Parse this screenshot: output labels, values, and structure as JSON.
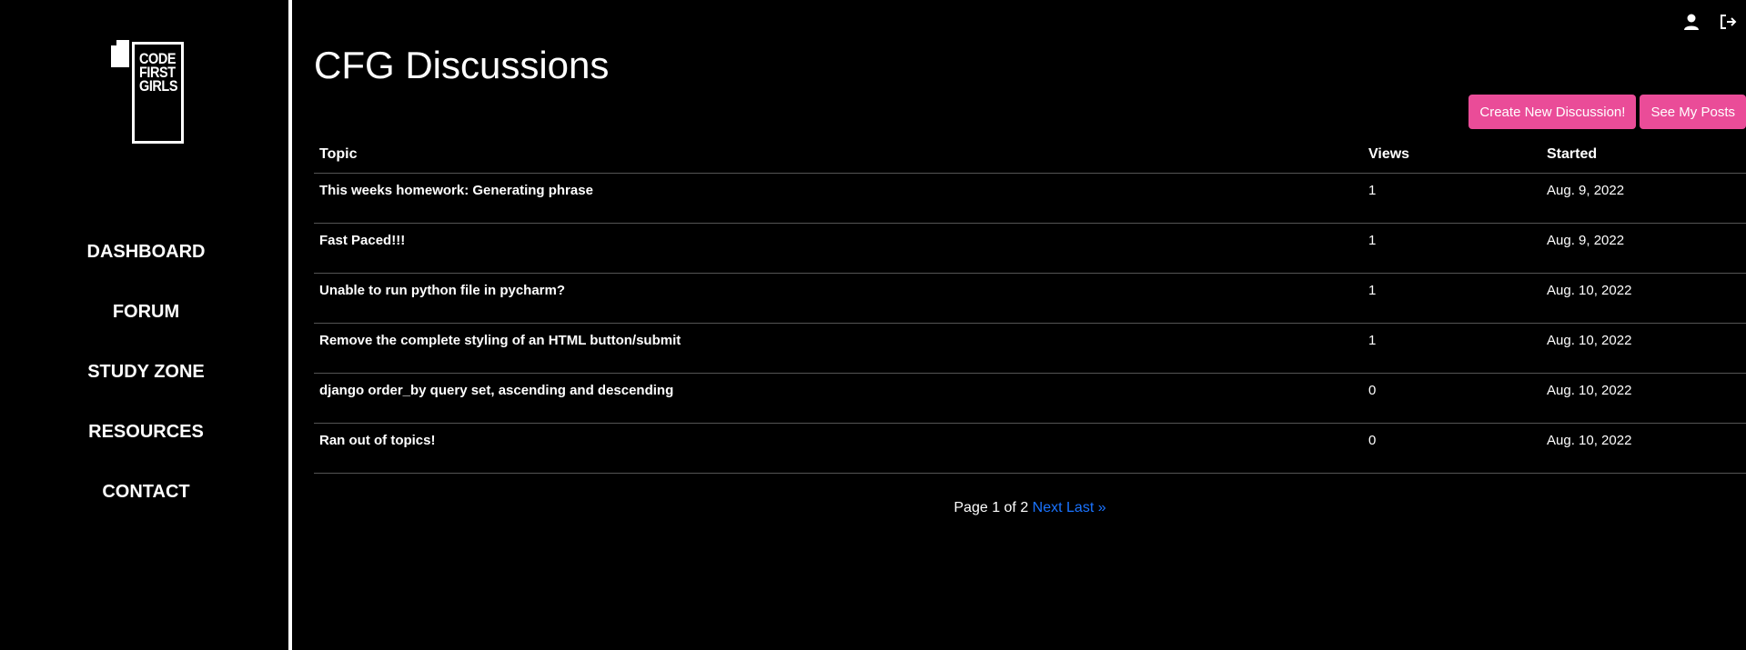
{
  "brand": {
    "logo_lines": [
      "CODE",
      "FIRST",
      "GIRLS"
    ]
  },
  "sidebar": {
    "items": [
      {
        "label": "DASHBOARD"
      },
      {
        "label": "FORUM"
      },
      {
        "label": "STUDY ZONE"
      },
      {
        "label": "RESOURCES"
      },
      {
        "label": "CONTACT"
      }
    ]
  },
  "header": {
    "icons": [
      "user-icon",
      "logout-icon"
    ]
  },
  "main": {
    "title": "CFG Discussions",
    "actions": {
      "create_label": "Create New Discussion!",
      "my_posts_label": "See My Posts"
    },
    "table": {
      "columns": [
        "Topic",
        "Views",
        "Started"
      ],
      "rows": [
        {
          "topic": "This weeks homework: Generating phrase",
          "views": "1",
          "started": "Aug. 9, 2022"
        },
        {
          "topic": "Fast Paced!!!",
          "views": "1",
          "started": "Aug. 9, 2022"
        },
        {
          "topic": "Unable to run python file in pycharm?",
          "views": "1",
          "started": "Aug. 10, 2022"
        },
        {
          "topic": "Remove the complete styling of an HTML button/submit",
          "views": "1",
          "started": "Aug. 10, 2022"
        },
        {
          "topic": "django order_by query set, ascending and descending",
          "views": "0",
          "started": "Aug. 10, 2022"
        },
        {
          "topic": "Ran out of topics!",
          "views": "0",
          "started": "Aug. 10, 2022"
        }
      ]
    },
    "pagination": {
      "status": "Page 1 of 2",
      "next_label": "Next",
      "last_label": "Last »"
    }
  },
  "colors": {
    "background": "#000000",
    "accent_button": "#ea4c98",
    "link": "#1a73ff"
  }
}
